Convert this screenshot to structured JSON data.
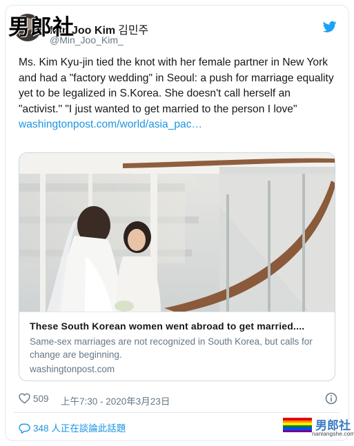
{
  "watermark": "男郎社",
  "author": {
    "display_name": "Min Joo Kim",
    "korean_name": "김민주",
    "handle": "@Min_Joo_Kim_"
  },
  "tweet": {
    "text": "Ms. Kim Kyu-jin tied the knot with her female partner in New York and had a \"factory wedding\" in Seoul: a push for marriage equality yet to be legalized in S.Korea. She doesn't call herself an \"activist.\" \"I just wanted to get married to the person I love\"",
    "link_text": "washingtonpost.com/world/asia_pac…"
  },
  "link_card": {
    "title": "These South Korean women went abroad to get married....",
    "description": "Same-sex marriages are not recognized in South Korea, but calls for change are beginning.",
    "domain": "washingtonpost.com"
  },
  "meta": {
    "likes": "509",
    "timestamp": "上午7:30 - 2020年3月23日"
  },
  "talk_label": "348 人正在談論此話題",
  "brand": {
    "name": "男郎社",
    "url": "nanlangshe.com"
  },
  "icons": {
    "twitter": "twitter-bird-icon",
    "heart": "heart-icon",
    "info": "info-icon",
    "comment": "comment-icon"
  },
  "colors": {
    "link": "#1b95e0",
    "twitter_blue": "#1da1f2",
    "muted": "#657786",
    "border": "#e1e8ed"
  }
}
